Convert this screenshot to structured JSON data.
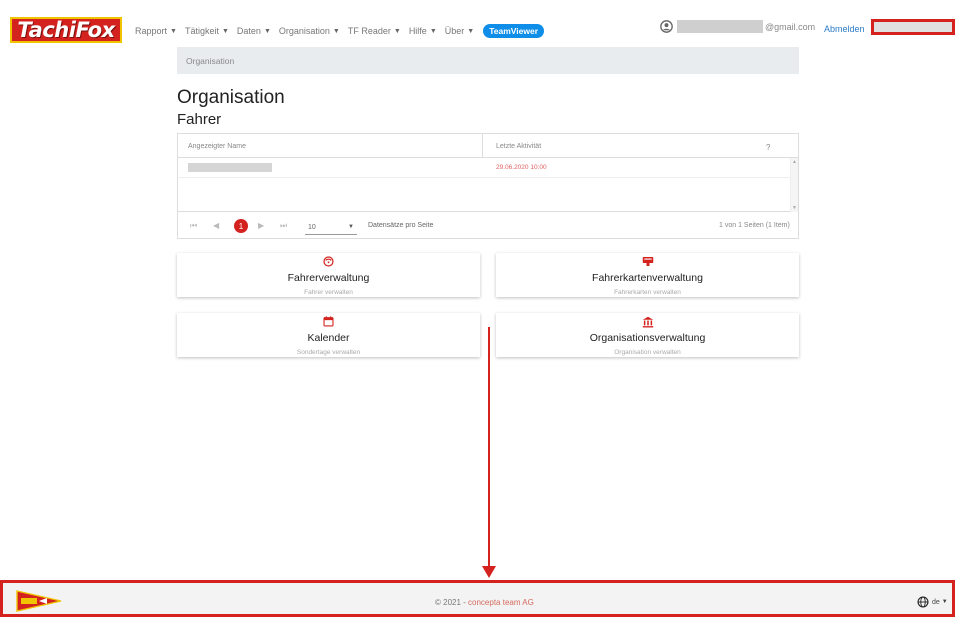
{
  "navbar": {
    "logo_text": "TachiFox",
    "menu": [
      {
        "label": "Rapport",
        "dropdown": true
      },
      {
        "label": "Tätigkeit",
        "dropdown": true
      },
      {
        "label": "Daten",
        "dropdown": true
      },
      {
        "label": "Organisation",
        "dropdown": true
      },
      {
        "label": "TF Reader",
        "dropdown": true
      },
      {
        "label": "Hilfe",
        "dropdown": true
      },
      {
        "label": "Über",
        "dropdown": true
      }
    ],
    "teamviewer_label": "TeamViewer",
    "email_suffix": "@gmail.com",
    "logout_label": "Abmelden"
  },
  "breadcrumb": "Organisation",
  "page_title": "Organisation",
  "section_title": "Fahrer",
  "grid": {
    "columns": [
      "Angezeigter Name",
      "Letzte Aktivität"
    ],
    "help_symbol": "?",
    "rows": [
      {
        "activity": "29.06.2020 10:00"
      }
    ],
    "pager": {
      "current_page": "1",
      "page_size": "10",
      "per_page_label": "Datensätze pro Seite",
      "info": "1 von 1 Seiten (1 Item)"
    }
  },
  "cards": [
    {
      "title": "Fahrerverwaltung",
      "subtitle": "Fahrer verwalten",
      "icon": "driver-icon"
    },
    {
      "title": "Fahrerkartenverwaltung",
      "subtitle": "Fahrerkarten verwalten",
      "icon": "card-icon"
    },
    {
      "title": "Kalender",
      "subtitle": "Sondertage verwalten",
      "icon": "calendar-icon"
    },
    {
      "title": "Organisationsverwaltung",
      "subtitle": "Organisation verwalten",
      "icon": "building-icon"
    }
  ],
  "footer": {
    "copyright": "© 2021 - ",
    "company": "concepta team AG",
    "language": "de"
  },
  "colors": {
    "brand_red": "#d4231f",
    "teamviewer_blue": "#0e8ee9",
    "link_blue": "#2c7cc7"
  }
}
